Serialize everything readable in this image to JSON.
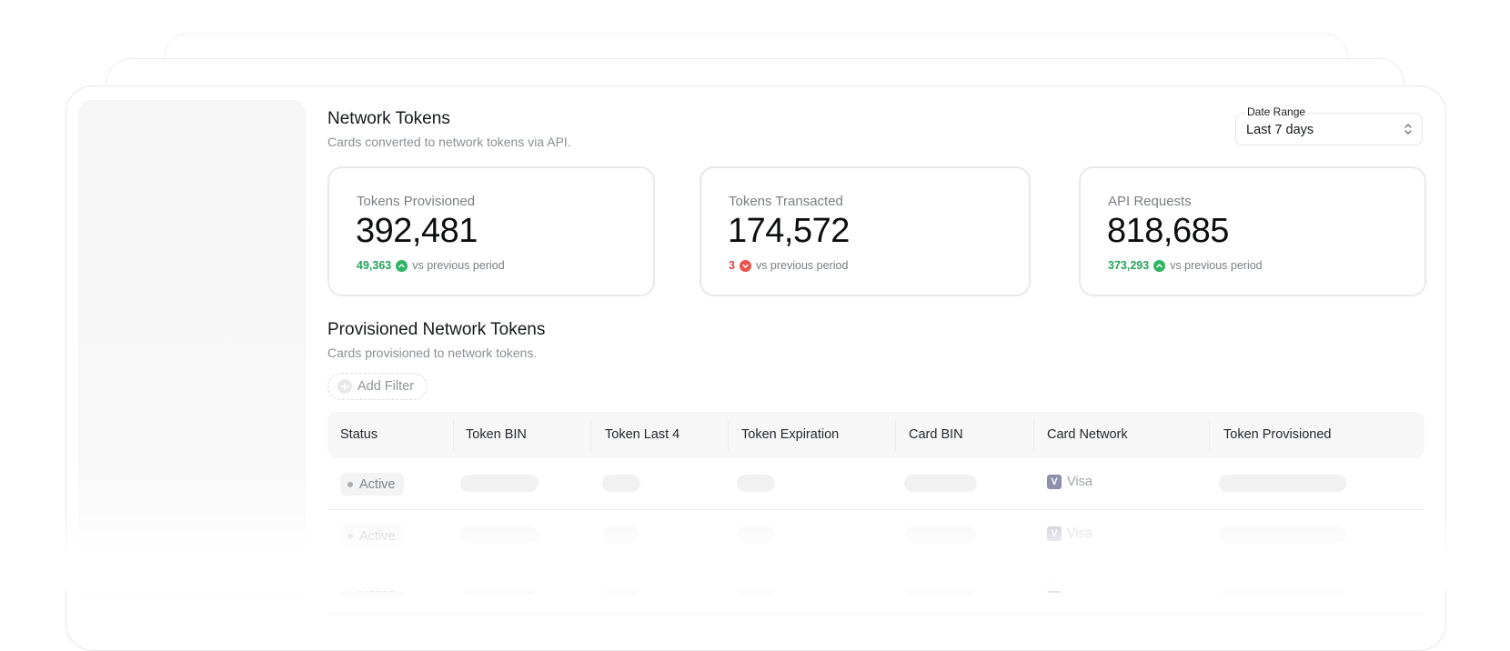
{
  "header": {
    "title": "Network Tokens",
    "subtitle": "Cards converted to network tokens via API."
  },
  "date_range": {
    "label": "Date Range",
    "value": "Last 7 days"
  },
  "stats": [
    {
      "label": "Tokens Provisioned",
      "value": "392,481",
      "delta": "49,363",
      "trend": "up",
      "comparison": "vs previous period"
    },
    {
      "label": "Tokens Transacted",
      "value": "174,572",
      "delta": "3",
      "trend": "down",
      "comparison": "vs previous period"
    },
    {
      "label": "API Requests",
      "value": "818,685",
      "delta": "373,293",
      "trend": "up",
      "comparison": "vs previous period"
    }
  ],
  "section": {
    "title": "Provisioned Network Tokens",
    "subtitle": "Cards provisioned to network tokens."
  },
  "filter": {
    "add_label": "Add Filter"
  },
  "table": {
    "columns": [
      "Status",
      "Token BIN",
      "Token Last 4",
      "Token Expiration",
      "Card BIN",
      "Card Network",
      "Token Provisioned"
    ],
    "rows": [
      {
        "status": "Active",
        "network": "Visa"
      },
      {
        "status": "Active",
        "network": "Visa"
      },
      {
        "status": "Active",
        "network": "Visa"
      }
    ]
  },
  "colors": {
    "positive": "#22a35a",
    "negative": "#e0453f",
    "visa_badge": "#8d90ac"
  },
  "icons": {
    "trend_up": "trend-up-icon",
    "trend_down": "trend-down-icon",
    "add_filter": "plus-circle-icon",
    "select": "chevron-up-down-icon",
    "network": "visa-icon"
  }
}
